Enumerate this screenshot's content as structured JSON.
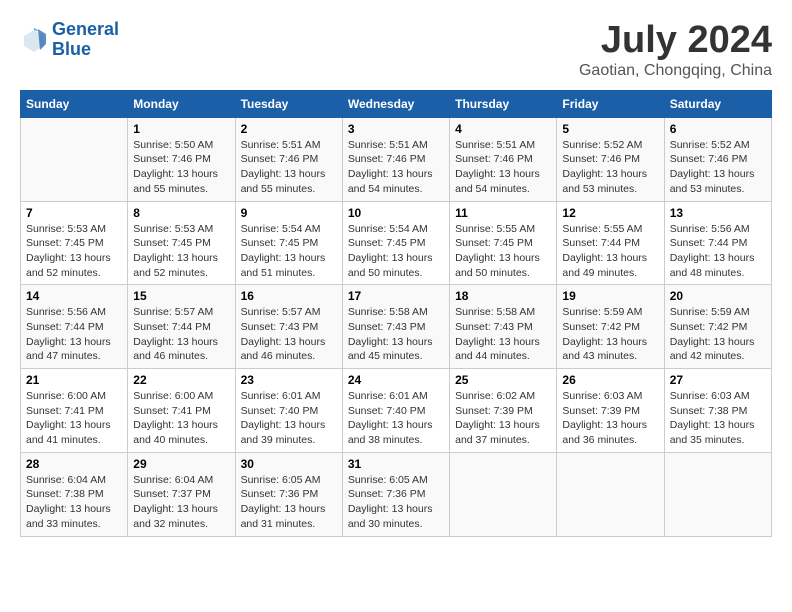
{
  "logo": {
    "line1": "General",
    "line2": "Blue"
  },
  "title": "July 2024",
  "subtitle": "Gaotian, Chongqing, China",
  "days_header": [
    "Sunday",
    "Monday",
    "Tuesday",
    "Wednesday",
    "Thursday",
    "Friday",
    "Saturday"
  ],
  "weeks": [
    [
      {
        "day": "",
        "info": ""
      },
      {
        "day": "1",
        "info": "Sunrise: 5:50 AM\nSunset: 7:46 PM\nDaylight: 13 hours\nand 55 minutes."
      },
      {
        "day": "2",
        "info": "Sunrise: 5:51 AM\nSunset: 7:46 PM\nDaylight: 13 hours\nand 55 minutes."
      },
      {
        "day": "3",
        "info": "Sunrise: 5:51 AM\nSunset: 7:46 PM\nDaylight: 13 hours\nand 54 minutes."
      },
      {
        "day": "4",
        "info": "Sunrise: 5:51 AM\nSunset: 7:46 PM\nDaylight: 13 hours\nand 54 minutes."
      },
      {
        "day": "5",
        "info": "Sunrise: 5:52 AM\nSunset: 7:46 PM\nDaylight: 13 hours\nand 53 minutes."
      },
      {
        "day": "6",
        "info": "Sunrise: 5:52 AM\nSunset: 7:46 PM\nDaylight: 13 hours\nand 53 minutes."
      }
    ],
    [
      {
        "day": "7",
        "info": "Sunrise: 5:53 AM\nSunset: 7:45 PM\nDaylight: 13 hours\nand 52 minutes."
      },
      {
        "day": "8",
        "info": "Sunrise: 5:53 AM\nSunset: 7:45 PM\nDaylight: 13 hours\nand 52 minutes."
      },
      {
        "day": "9",
        "info": "Sunrise: 5:54 AM\nSunset: 7:45 PM\nDaylight: 13 hours\nand 51 minutes."
      },
      {
        "day": "10",
        "info": "Sunrise: 5:54 AM\nSunset: 7:45 PM\nDaylight: 13 hours\nand 50 minutes."
      },
      {
        "day": "11",
        "info": "Sunrise: 5:55 AM\nSunset: 7:45 PM\nDaylight: 13 hours\nand 50 minutes."
      },
      {
        "day": "12",
        "info": "Sunrise: 5:55 AM\nSunset: 7:44 PM\nDaylight: 13 hours\nand 49 minutes."
      },
      {
        "day": "13",
        "info": "Sunrise: 5:56 AM\nSunset: 7:44 PM\nDaylight: 13 hours\nand 48 minutes."
      }
    ],
    [
      {
        "day": "14",
        "info": "Sunrise: 5:56 AM\nSunset: 7:44 PM\nDaylight: 13 hours\nand 47 minutes."
      },
      {
        "day": "15",
        "info": "Sunrise: 5:57 AM\nSunset: 7:44 PM\nDaylight: 13 hours\nand 46 minutes."
      },
      {
        "day": "16",
        "info": "Sunrise: 5:57 AM\nSunset: 7:43 PM\nDaylight: 13 hours\nand 46 minutes."
      },
      {
        "day": "17",
        "info": "Sunrise: 5:58 AM\nSunset: 7:43 PM\nDaylight: 13 hours\nand 45 minutes."
      },
      {
        "day": "18",
        "info": "Sunrise: 5:58 AM\nSunset: 7:43 PM\nDaylight: 13 hours\nand 44 minutes."
      },
      {
        "day": "19",
        "info": "Sunrise: 5:59 AM\nSunset: 7:42 PM\nDaylight: 13 hours\nand 43 minutes."
      },
      {
        "day": "20",
        "info": "Sunrise: 5:59 AM\nSunset: 7:42 PM\nDaylight: 13 hours\nand 42 minutes."
      }
    ],
    [
      {
        "day": "21",
        "info": "Sunrise: 6:00 AM\nSunset: 7:41 PM\nDaylight: 13 hours\nand 41 minutes."
      },
      {
        "day": "22",
        "info": "Sunrise: 6:00 AM\nSunset: 7:41 PM\nDaylight: 13 hours\nand 40 minutes."
      },
      {
        "day": "23",
        "info": "Sunrise: 6:01 AM\nSunset: 7:40 PM\nDaylight: 13 hours\nand 39 minutes."
      },
      {
        "day": "24",
        "info": "Sunrise: 6:01 AM\nSunset: 7:40 PM\nDaylight: 13 hours\nand 38 minutes."
      },
      {
        "day": "25",
        "info": "Sunrise: 6:02 AM\nSunset: 7:39 PM\nDaylight: 13 hours\nand 37 minutes."
      },
      {
        "day": "26",
        "info": "Sunrise: 6:03 AM\nSunset: 7:39 PM\nDaylight: 13 hours\nand 36 minutes."
      },
      {
        "day": "27",
        "info": "Sunrise: 6:03 AM\nSunset: 7:38 PM\nDaylight: 13 hours\nand 35 minutes."
      }
    ],
    [
      {
        "day": "28",
        "info": "Sunrise: 6:04 AM\nSunset: 7:38 PM\nDaylight: 13 hours\nand 33 minutes."
      },
      {
        "day": "29",
        "info": "Sunrise: 6:04 AM\nSunset: 7:37 PM\nDaylight: 13 hours\nand 32 minutes."
      },
      {
        "day": "30",
        "info": "Sunrise: 6:05 AM\nSunset: 7:36 PM\nDaylight: 13 hours\nand 31 minutes."
      },
      {
        "day": "31",
        "info": "Sunrise: 6:05 AM\nSunset: 7:36 PM\nDaylight: 13 hours\nand 30 minutes."
      },
      {
        "day": "",
        "info": ""
      },
      {
        "day": "",
        "info": ""
      },
      {
        "day": "",
        "info": ""
      }
    ]
  ]
}
